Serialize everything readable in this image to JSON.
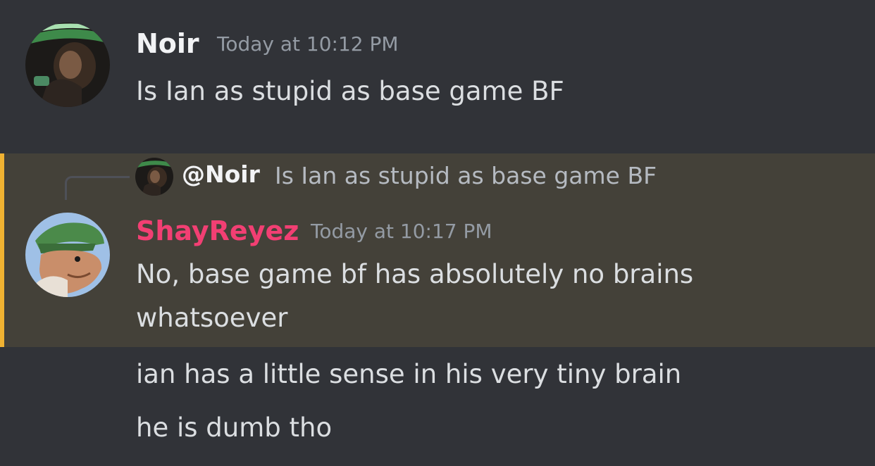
{
  "colors": {
    "background": "#313338",
    "highlight_background": "#444139",
    "highlight_bar": "#f0b232",
    "noir_name": "#f2f3f5",
    "shay_name": "#f23f73",
    "timestamp": "#949ba4",
    "message_text": "#dbdee1",
    "reply_text": "#b5bac1"
  },
  "messages": [
    {
      "username": "Noir",
      "timestamp": "Today at 10:12 PM",
      "avatar_icon": "noir-avatar-icon",
      "lines": [
        "Is Ian as stupid as base game BF"
      ]
    },
    {
      "reply": {
        "mention": "@Noir",
        "text": "Is Ian as stupid as base game BF",
        "avatar_icon": "noir-avatar-icon"
      },
      "username": "ShayReyez",
      "timestamp": "Today at 10:17 PM",
      "avatar_icon": "shayreyez-avatar-icon",
      "lines": [
        "No, base game bf has absolutely no brains",
        "whatsoever"
      ]
    },
    {
      "lines": [
        "ian has a little sense in his very tiny brain"
      ]
    },
    {
      "lines": [
        "he is dumb tho"
      ]
    }
  ]
}
